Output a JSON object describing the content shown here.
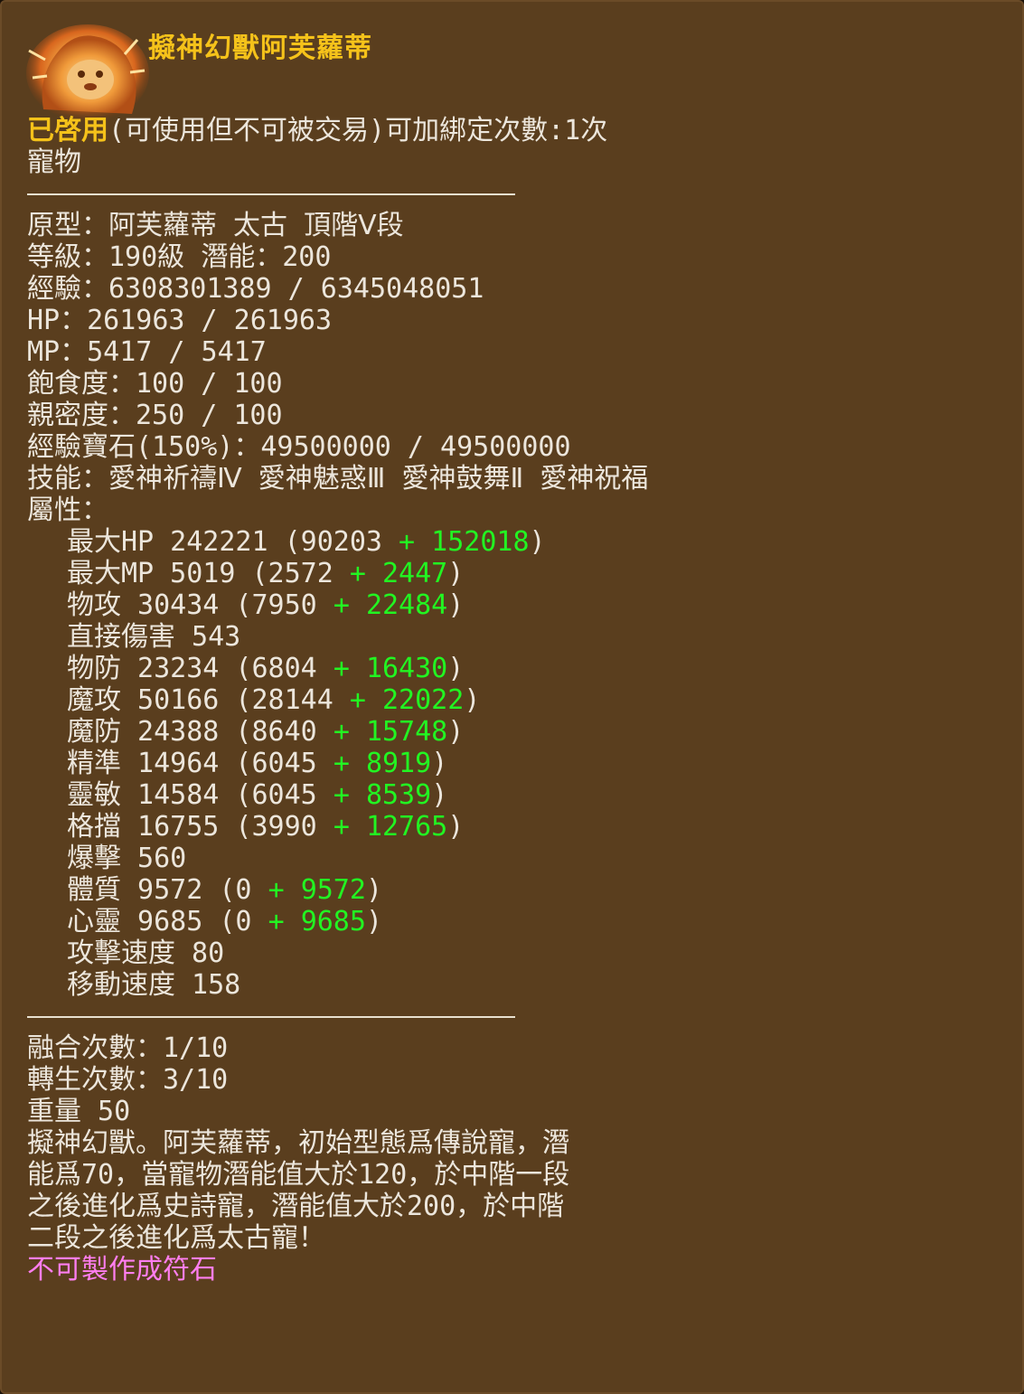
{
  "item": {
    "name": "擬神幻獸阿芙蘿蒂",
    "status": "已啓用",
    "bind_info": "(可使用但不可被交易)可加綁定次數:1次",
    "category": "寵物",
    "colors": {
      "background": "#5a3e1e",
      "title": "#f5c21a",
      "text": "#ece6dc",
      "bonus": "#22f522",
      "note": "#ff7ef0"
    },
    "icon": "fire-lion-pet-icon"
  },
  "info": [
    "原型：阿芙蘿蒂 太古 頂階Ⅴ段",
    "等級：190級 潛能：200",
    "經驗：6308301389 / 6345048051",
    "HP：261963 / 261963",
    "MP：5417 / 5417",
    "飽食度：100 / 100",
    "親密度：250 / 100",
    "經驗寶石(150%)：49500000 / 49500000",
    "技能：愛神祈禱Ⅳ 愛神魅惑Ⅲ 愛神鼓舞Ⅱ 愛神祝福",
    "屬性："
  ],
  "attributes": [
    {
      "base": "最大HP 242221 (90203 ",
      "plus": "+ ",
      "bonus": "152018",
      "close": ")"
    },
    {
      "base": "最大MP 5019 (2572 ",
      "plus": "+ ",
      "bonus": "2447",
      "close": ")"
    },
    {
      "base": "物攻 30434 (7950 ",
      "plus": "+ ",
      "bonus": "22484",
      "close": ")"
    },
    {
      "base": "直接傷害 543",
      "plus": "",
      "bonus": "",
      "close": ""
    },
    {
      "base": "物防 23234 (6804 ",
      "plus": "+ ",
      "bonus": "16430",
      "close": ")"
    },
    {
      "base": "魔攻 50166 (28144 ",
      "plus": "+ ",
      "bonus": "22022",
      "close": ")"
    },
    {
      "base": "魔防 24388 (8640 ",
      "plus": "+ ",
      "bonus": "15748",
      "close": ")"
    },
    {
      "base": "精準 14964 (6045 ",
      "plus": "+ ",
      "bonus": "8919",
      "close": ")"
    },
    {
      "base": "靈敏 14584 (6045 ",
      "plus": "+ ",
      "bonus": "8539",
      "close": ")"
    },
    {
      "base": "格擋 16755 (3990 ",
      "plus": "+ ",
      "bonus": "12765",
      "close": ")"
    },
    {
      "base": "爆擊 560",
      "plus": "",
      "bonus": "",
      "close": ""
    },
    {
      "base": "體質 9572 (0 ",
      "plus": "+ ",
      "bonus": "9572",
      "close": ")"
    },
    {
      "base": "心靈 9685 (0 ",
      "plus": "+ ",
      "bonus": "9685",
      "close": ")"
    },
    {
      "base": "攻擊速度 80",
      "plus": "",
      "bonus": "",
      "close": ""
    },
    {
      "base": "移動速度 158",
      "plus": "",
      "bonus": "",
      "close": ""
    }
  ],
  "footer": [
    "融合次數：1/10",
    "轉生次數：3/10",
    "重量 50",
    "擬神幻獸。阿芙蘿蒂，初始型態爲傳說寵，潛",
    "能爲70，當寵物潛能值大於120，於中階一段",
    "之後進化爲史詩寵，潛能值大於200，於中階",
    "二段之後進化爲太古寵！"
  ],
  "note": "不可製作成符石"
}
